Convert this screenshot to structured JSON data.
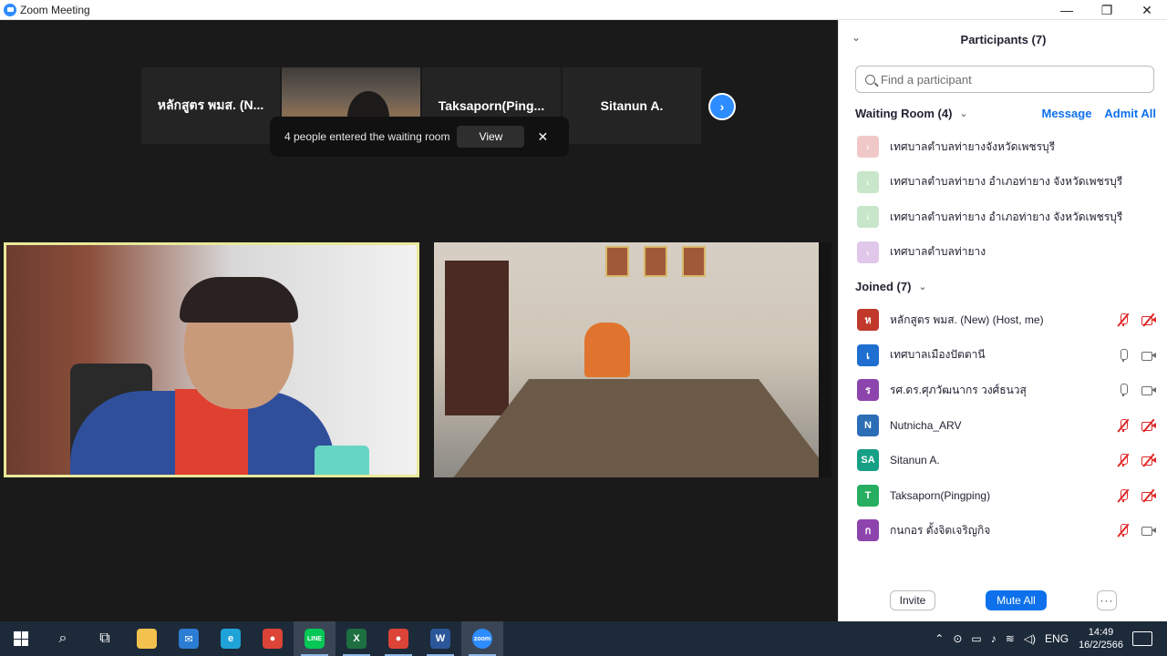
{
  "window": {
    "title": "Zoom Meeting",
    "minimize": "—",
    "restore": "❐",
    "close": "✕"
  },
  "strip": {
    "tiles": [
      {
        "name": "หลักสูตร พมส. (N..."
      },
      {
        "name": ""
      },
      {
        "name": "Taksaporn(Ping..."
      },
      {
        "name": "Sitanun A."
      }
    ],
    "next_glyph": "›"
  },
  "toast": {
    "text": "4 people entered the waiting room",
    "view_label": "View",
    "close_glyph": "✕"
  },
  "panel": {
    "title": "Participants (7)",
    "collapse_glyph": "⌄",
    "search_placeholder": "Find a participant",
    "waiting": {
      "title": "Waiting Room (4)",
      "chevron": "⌄",
      "message_label": "Message",
      "admit_all_label": "Admit All",
      "items": [
        {
          "initial": "เ",
          "name": "เทศบาลตำบลท่ายางจังหวัดเพชรบุรี",
          "color": "#f0c8c8"
        },
        {
          "initial": "เ",
          "name": "เทศบาลตำบลท่ายาง อำเภอท่ายาง จังหวัดเพชรบุรี",
          "color": "#c8e6c9"
        },
        {
          "initial": "เ",
          "name": "เทศบาลตำบลท่ายาง อำเภอท่ายาง จังหวัดเพชรบุรี",
          "color": "#c8e6c9"
        },
        {
          "initial": "เ",
          "name": "เทศบาลตำบลท่ายาง",
          "color": "#e1c8ea"
        }
      ]
    },
    "joined": {
      "title": "Joined (7)",
      "chevron": "⌄",
      "items": [
        {
          "initial": "ห",
          "name": "หลักสูตร พมส. (New) (Host, me)",
          "color": "#c0392b",
          "mic_muted": true,
          "cam_off": true
        },
        {
          "initial": "เ",
          "name": "เทศบาลเมืองปัตตานี",
          "color": "#1e6fd0",
          "mic_muted": false,
          "cam_off": false
        },
        {
          "initial": "ร",
          "name": "รศ.ดร.ศุภวัฒนากร วงศ์ธนวสุ",
          "color": "#8e44ad",
          "mic_muted": false,
          "cam_off": false
        },
        {
          "initial": "N",
          "name": "Nutnicha_ARV",
          "color": "#2c6eb5",
          "mic_muted": true,
          "cam_off": true
        },
        {
          "initial": "SA",
          "name": "Sitanun A.",
          "color": "#16a085",
          "mic_muted": true,
          "cam_off": true
        },
        {
          "initial": "T",
          "name": "Taksaporn(Pingping)",
          "color": "#27ae60",
          "mic_muted": true,
          "cam_off": true
        },
        {
          "initial": "ก",
          "name": "กนกอร ตั้งจิตเจริญกิจ",
          "color": "#8e44ad",
          "mic_muted": true,
          "cam_off": false
        }
      ]
    },
    "footer": {
      "invite_label": "Invite",
      "mute_all_label": "Mute All",
      "more_label": "···"
    }
  },
  "taskbar": {
    "apps": [
      {
        "icon": "search-icon",
        "glyph": "⌕",
        "color": "transparent"
      },
      {
        "icon": "task-view-icon",
        "glyph": "⧉",
        "color": "transparent"
      },
      {
        "icon": "file-explorer-icon",
        "glyph": "",
        "color": "#f2c14e"
      },
      {
        "icon": "mail-icon",
        "glyph": "✉",
        "color": "#2b7cd3"
      },
      {
        "icon": "edge-icon",
        "glyph": "e",
        "color": "#1fa2d8"
      },
      {
        "icon": "chrome-icon",
        "glyph": "●",
        "color": "#db4437"
      },
      {
        "icon": "line-icon",
        "glyph": "LINE",
        "color": "#06c755"
      },
      {
        "icon": "excel-icon",
        "glyph": "X",
        "color": "#1d6f42"
      },
      {
        "icon": "chrome-icon",
        "glyph": "●",
        "color": "#db4437"
      },
      {
        "icon": "word-icon",
        "glyph": "W",
        "color": "#2b579a"
      },
      {
        "icon": "zoom-icon",
        "glyph": "zoom",
        "color": "#2d8cff"
      }
    ],
    "tray": {
      "language": "ENG",
      "time": "14:49",
      "date": "16/2/2566"
    }
  }
}
